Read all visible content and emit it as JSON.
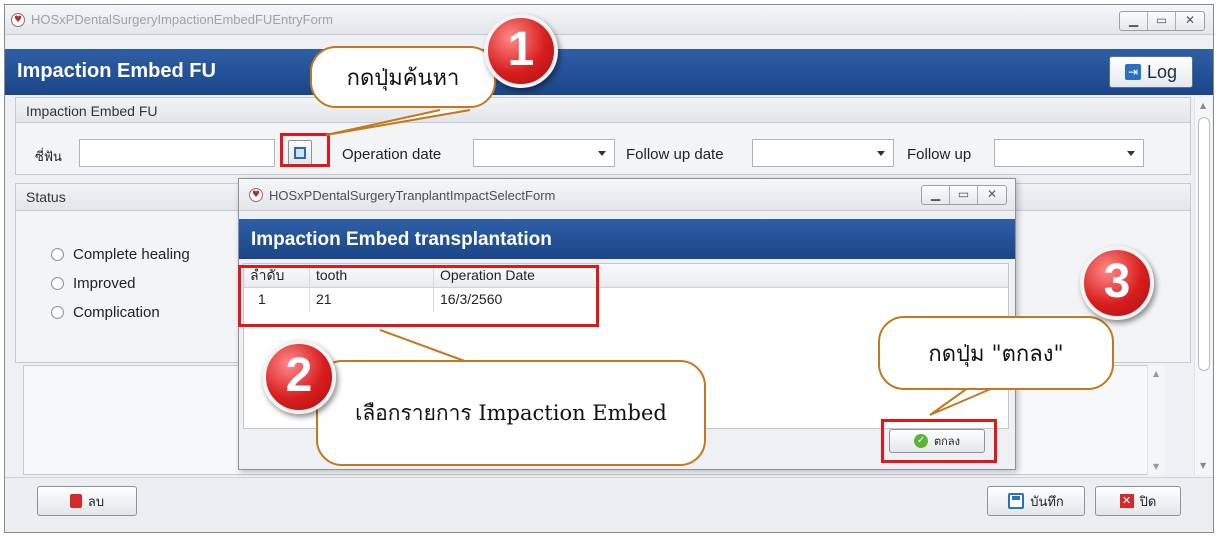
{
  "window": {
    "title": "HOSxPDentalSurgeryImpactionEmbedFUEntryForm",
    "banner_title": "Impaction Embed FU",
    "log_label": "Log",
    "section_title": "Impaction Embed FU",
    "tooth_label": "ซี่ฟัน",
    "tooth_value": "",
    "operation_date_label": "Operation date",
    "operation_date_value": "",
    "follow_up_date_label": "Follow up date",
    "follow_up_date_value": "",
    "follow_up_label": "Follow up",
    "follow_up_value": "",
    "status_title": "Status",
    "status_options": [
      "Complete healing",
      "Improved",
      "Complication"
    ],
    "delete_label": "ลบ",
    "save_label": "บันทึก",
    "close_label": "ปิด"
  },
  "dialog": {
    "title": "HOSxPDentalSurgeryTranplantImpactSelectForm",
    "banner_title": "Impaction Embed transplantation",
    "columns": [
      "ลำดับ",
      "tooth",
      "Operation Date"
    ],
    "rows": [
      {
        "no": "1",
        "tooth": "21",
        "operation_date": "16/3/2560"
      }
    ],
    "ok_label": "ตกลง"
  },
  "annotations": {
    "step1_number": "1",
    "step1_text": "กดปุ่มค้นหา",
    "step2_number": "2",
    "step2_text": "เลือกรายการ Impaction Embed",
    "step3_number": "3",
    "step3_text": "กดปุ่ม \"ตกลง\"",
    "highlight_color": "#e4161c",
    "badge_color": "#d81e1e"
  },
  "icons": [
    "app-icon",
    "log-icon",
    "search-icon",
    "dropdown-arrow-icon",
    "delete-icon",
    "save-icon",
    "close-icon",
    "ok-check-icon"
  ]
}
